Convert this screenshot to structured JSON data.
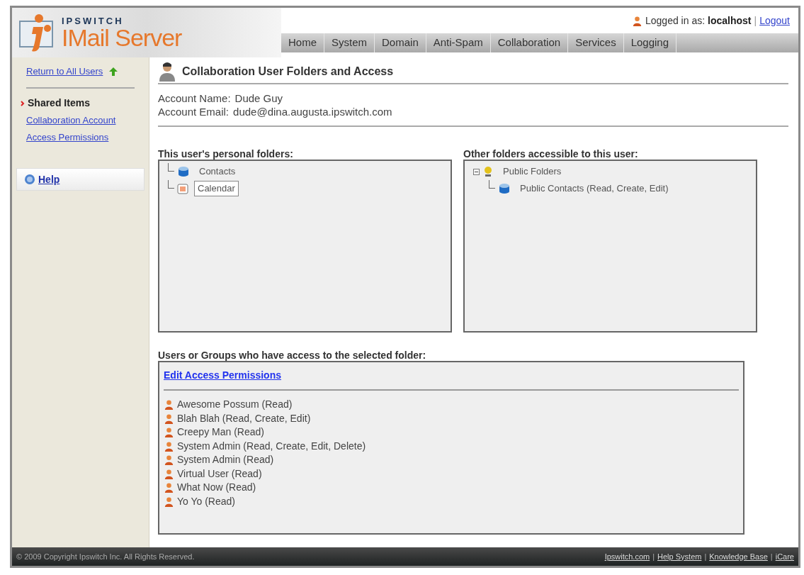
{
  "brand": {
    "company": "IPSWITCH",
    "product": "IMail Server"
  },
  "user_bar": {
    "label": "Logged in as:",
    "user": "localhost",
    "separator": "|",
    "logout": "Logout"
  },
  "nav": [
    "Home",
    "System",
    "Domain",
    "Anti-Spam",
    "Collaboration",
    "Services",
    "Logging"
  ],
  "sidebar": {
    "back_link": "Return to All Users",
    "section": "Shared Items",
    "links": [
      "Collaboration Account",
      "Access Permissions"
    ],
    "help": "Help"
  },
  "page_title": "Collaboration User Folders and Access",
  "account": [
    {
      "label": "Account Name:",
      "value": "Dude Guy"
    },
    {
      "label": "Account Email:",
      "value": "dude@dina.augusta.ipswitch.com"
    }
  ],
  "personal_folders": {
    "heading": "This user's personal folders:",
    "items": [
      {
        "name": "Contacts",
        "kind": "contacts",
        "selected": false
      },
      {
        "name": "Calendar",
        "kind": "calendar",
        "selected": true
      }
    ]
  },
  "other_folders": {
    "heading": "Other folders accessible to this user:",
    "items": [
      {
        "name": "Public Folders",
        "kind": "public",
        "expanded": true,
        "selected": false,
        "children": [
          {
            "name": "Public Contacts (Read, Create, Edit)",
            "kind": "contacts",
            "selected": false
          }
        ]
      }
    ]
  },
  "access": {
    "heading": "Users or Groups who have access to the selected folder:",
    "edit_link": "Edit Access Permissions",
    "entries": [
      "Awesome Possum (Read)",
      "Blah Blah (Read, Create, Edit)",
      "Creepy Man (Read)",
      "System Admin (Read, Create, Edit, Delete)",
      "System Admin (Read)",
      "Virtual User (Read)",
      "What Now (Read)",
      "Yo Yo (Read)"
    ]
  },
  "footer": {
    "copyright": "© 2009 Copyright Ipswitch Inc. All Rights Reserved.",
    "separator": "|",
    "links": [
      "Ipswitch.com",
      "Help System",
      "Knowledge Base",
      "iCare"
    ]
  }
}
